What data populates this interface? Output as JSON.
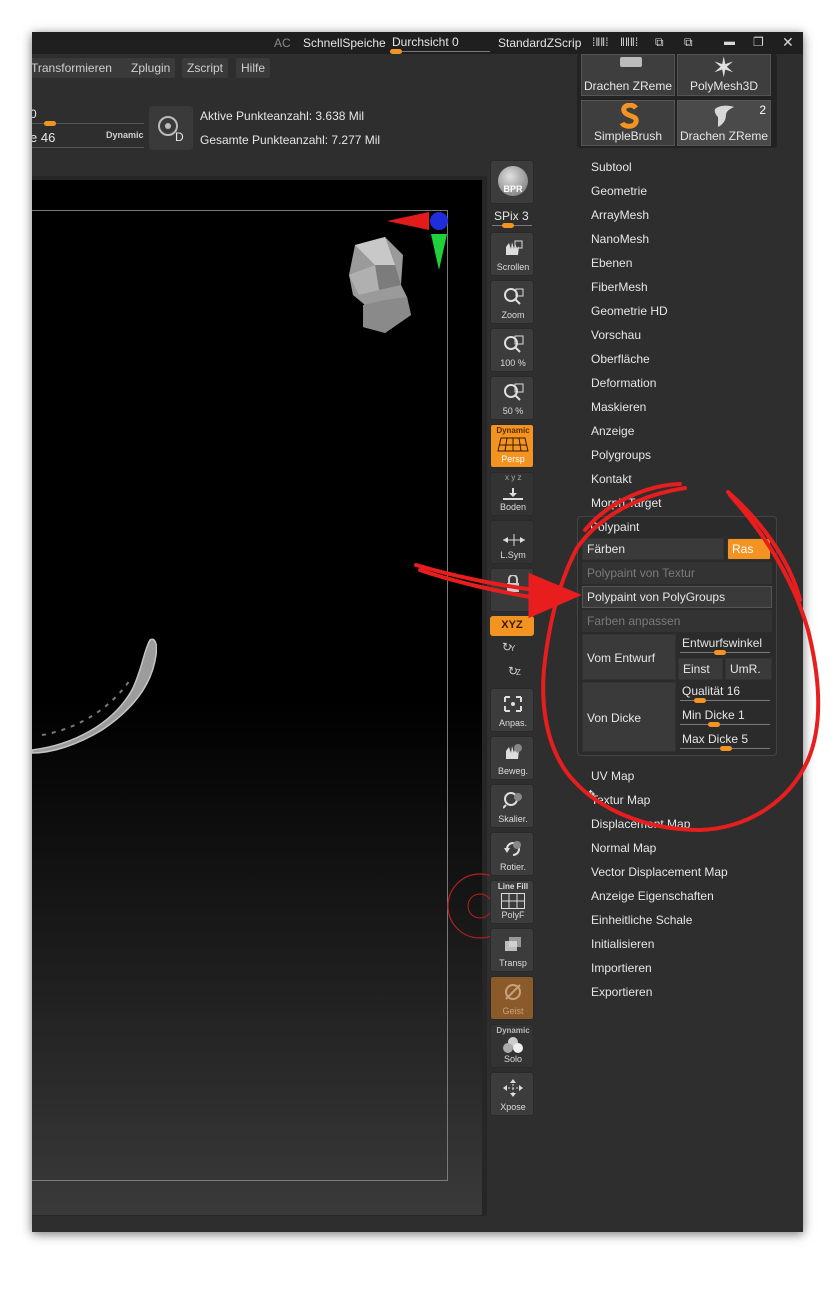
{
  "titlebar": {
    "ac": "AC",
    "quicksave": "SchnellSpeiche",
    "transparency_label": "Durchsicht 0",
    "standard_script": "StandardZScrip"
  },
  "menubar": {
    "items": [
      "Transformieren",
      "Zplugin",
      "Zscript",
      "Hilfe"
    ]
  },
  "info": {
    "draw_value_fragment": "0",
    "size_label_fragment": "e 46",
    "dynamic": "Dynamic",
    "active_points": "Aktive Punkteanzahl: 3.638 Mil",
    "total_points": "Gesamte Punkteanzahl: 7.277 Mil",
    "d_glyph": "D"
  },
  "toolbar": {
    "bpr": "BPR",
    "spix": "SPix 3",
    "scroll": "Scrollen",
    "zoom": "Zoom",
    "zoom100": "100 %",
    "zoom50": "50 %",
    "persp_dynamic": "Dynamic",
    "persp": "Persp",
    "floor": "Boden",
    "lsym": "L.Sym",
    "xyz": "XYZ",
    "y_axis": "Y",
    "z_axis": "Z",
    "fit": "Anpas.",
    "move": "Beweg.",
    "scale": "Skalier.",
    "rotate": "Rotier.",
    "linefill": "Line Fill",
    "polyf": "PolyF",
    "transp": "Transp",
    "ghost": "Geist",
    "solo_dynamic": "Dynamic",
    "solo": "Solo",
    "xpose": "Xpose"
  },
  "thumbs": [
    {
      "label": "Drachen ZReme"
    },
    {
      "label": "PolyMesh3D"
    },
    {
      "label": "SimpleBrush"
    },
    {
      "label": "Drachen ZReme",
      "badge": "2"
    }
  ],
  "tool_menu": {
    "top_items": [
      "Subtool",
      "Geometrie",
      "ArrayMesh",
      "NanoMesh",
      "Ebenen",
      "FiberMesh",
      "Geometrie HD",
      "Vorschau",
      "Oberfläche",
      "Deformation",
      "Maskieren",
      "Anzeige",
      "Polygroups",
      "Kontakt",
      "Morph Target"
    ],
    "polypaint": {
      "title": "Polypaint",
      "colorize": "Färben",
      "grid": "Ras",
      "from_texture": "Polypaint von Textur",
      "from_polygroups": "Polypaint von PolyGroups",
      "adjust_colors": "Farben anpassen",
      "from_cavity": "Vom Entwurf",
      "cavity_angle": "Entwurfswinkel",
      "set": "Einst",
      "invert": "UmR.",
      "from_thickness": "Von Dicke",
      "quality": "Qualität 16",
      "min_thickness": "Min Dicke 1",
      "max_thickness": "Max Dicke 5"
    },
    "bottom_items": [
      "UV Map",
      "Textur Map",
      "Displacement Map",
      "Normal Map",
      "Vector Displacement Map",
      "Anzeige Eigenschaften",
      "Einheitliche Schale",
      "Initialisieren",
      "Importieren",
      "Exportieren"
    ]
  },
  "colors": {
    "accent": "#f39422",
    "annotation": "#e81e1e",
    "background": "#2e2e2e"
  }
}
